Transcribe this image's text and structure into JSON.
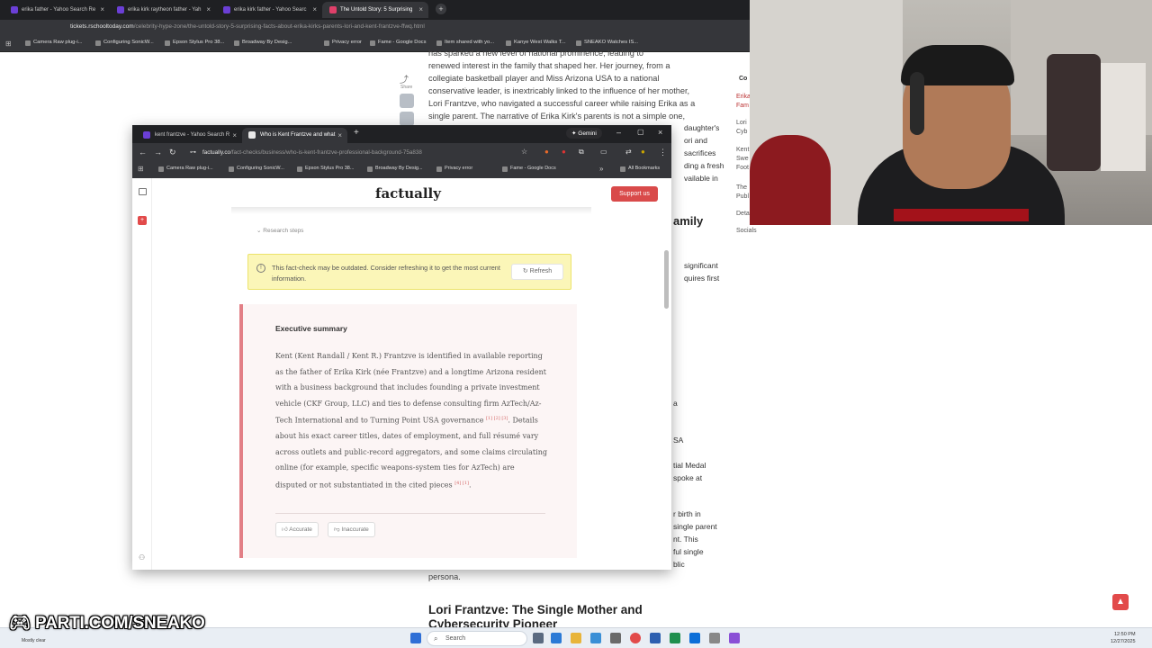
{
  "back_browser": {
    "tabs": [
      {
        "label": "erika father - Yahoo Search Re"
      },
      {
        "label": "erika kirk raytheon father - Yah"
      },
      {
        "label": "erika kirk father - Yahoo Searc"
      },
      {
        "label": "The Untold Story: 5 Surprising"
      }
    ],
    "url_domain": "tickets.rschooltoday.com",
    "url_path": "/celebrity-hype-zone/the-untold-story-5-surprising-facts-about-erika-kirks-parents-lori-and-kent-frantzve-ffwq.html",
    "bookmarks": [
      "Camera Raw plug-i...",
      "Configuring SonicW...",
      "Epson Stylus Pro 38...",
      "Broadway By Desig...",
      "Privacy error",
      "Fame - Google Docs",
      "Item shared with yo...",
      "Kanye West Walks T...",
      "SNEAKO Watches IS..."
    ],
    "share_label": "Share",
    "article_lines": [
      "has sparked a new level of national prominence, leading to",
      "renewed interest in the family that shaped her. Her journey, from a",
      "collegiate basketball player and Miss Arizona USA to a national",
      "conservative leader, is inextricably linked to the influence of her mother,",
      "Lori Frantzve, who navigated a successful career while raising Erika as a",
      "single parent. The narrative of Erika Kirk's parents is not a simple one,"
    ],
    "right_fragments": [
      "daughter's",
      "ori and",
      "sacrifices",
      "ding a fresh",
      "vailable in",
      "amily",
      "significant",
      "quires first",
      "a",
      "SA",
      "tial Medal",
      "spoke at",
      "r birth in",
      "single parent",
      "nt. This",
      "ful single",
      "blic"
    ],
    "toc": [
      "Co",
      "Erika",
      "Fam",
      "Lori",
      "Cyb",
      "Kent",
      "Swe",
      "Foot",
      "The",
      "Publ",
      "Deta",
      "Socials"
    ],
    "persona": "persona.",
    "heading": "Lori Frantzve: The Single Mother and",
    "heading_cut": "Cybersecurity Pioneer"
  },
  "front_browser": {
    "tabs": [
      {
        "label": "kent frantzve - Yahoo Search R"
      },
      {
        "label": "Who is Kent Frantzve and what"
      }
    ],
    "url_domain": "factually.co",
    "url_path": "/fact-checks/business/who-is-kent-frantzve-professional-background-75a838",
    "bookmarks": [
      "Camera Raw plug-i...",
      "Configuring SonicW...",
      "Epson Stylus Pro 38...",
      "Broadway By Desig...",
      "Privacy error",
      "Fame - Google Docs"
    ],
    "all_bookmarks": "All Bookmarks",
    "gemini": "Gemini",
    "logo": "factually",
    "support": "Support us",
    "research_steps": "Research steps",
    "banner_text": "This fact-check may be outdated. Consider refreshing it to get the most current information.",
    "refresh": "Refresh",
    "summary_title": "Executive summary",
    "summary_part1": "Kent (Kent Randall / Kent R.) Frantzve is identified in available reporting as the father of Erika Kirk (née Frantzve) and a longtime Arizona resident with a business background that includes founding a private investment vehicle (CKF Group, LLC) and ties to defense consulting firm AzTech/Az-Tech International and to Turning Point USA governance",
    "summary_refs1": "[1] [2] [3]",
    "summary_part2": ". Details about his exact career titles, dates of employment, and full résumé vary across outlets and public-record aggregators, and some claims circulating online (for example, specific weapons-system ties for AzTech) are disputed or not substantiated in the cited pieces",
    "summary_refs2": "[4] [1]",
    "summary_end": ".",
    "accurate": "Accurate",
    "inaccurate": "Inaccurate"
  },
  "overlay": {
    "parti": "PARTI.COM/SNEAKO",
    "weather": "Mostly clear"
  },
  "taskbar": {
    "search": "Search",
    "time": "12:50 PM",
    "date": "12/27/2025"
  },
  "colors": {
    "accent_red": "#e24a4a",
    "banner_yellow": "#fbf6b8",
    "summary_border": "#e27f86"
  }
}
